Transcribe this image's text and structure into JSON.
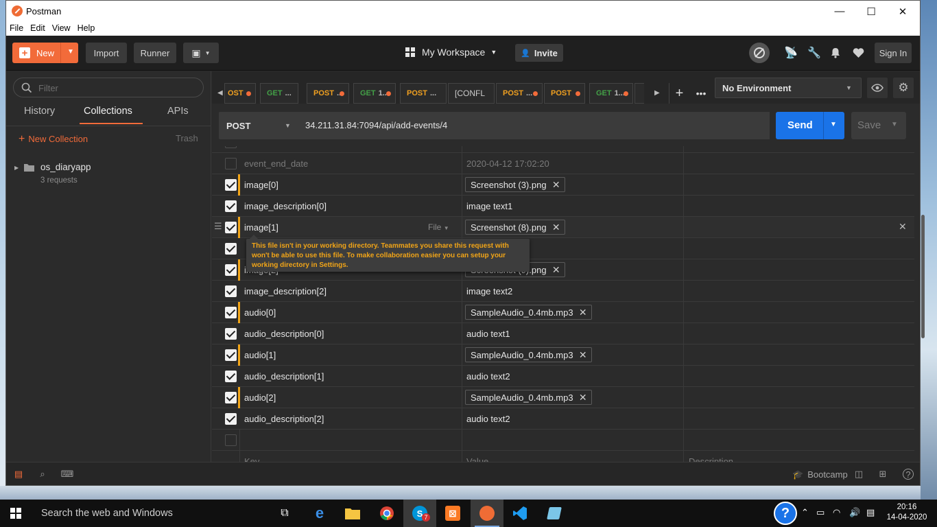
{
  "window": {
    "title": "Postman",
    "minimize": "—",
    "maximize": "☐",
    "close": "✕"
  },
  "menu": [
    "File",
    "Edit",
    "View",
    "Help"
  ],
  "header": {
    "new_label": "New",
    "import_label": "Import",
    "runner_label": "Runner",
    "workspace_label": "My Workspace",
    "invite_label": "Invite",
    "signin_label": "Sign In"
  },
  "sidebar": {
    "filter_placeholder": "Filter",
    "tabs": [
      "History",
      "Collections",
      "APIs"
    ],
    "new_collection": "New Collection",
    "trash": "Trash",
    "collection": {
      "name": "os_diaryapp",
      "count": "3 requests"
    }
  },
  "tabs": [
    {
      "method": "OST",
      "dot": true
    },
    {
      "method": "GET",
      "label": "...",
      "dot": false
    },
    {
      "method": "POST",
      "label": "...",
      "dot": true
    },
    {
      "method": "GET",
      "label": "1...",
      "dot": true
    },
    {
      "method": "POST",
      "label": "...",
      "dot": false
    },
    {
      "method": "",
      "label": "[CONFL",
      "dot": false
    },
    {
      "method": "POST",
      "label": "...",
      "dot": true
    },
    {
      "method": "POST",
      "label": "",
      "dot": true
    },
    {
      "method": "GET",
      "label": "1...",
      "dot": true
    }
  ],
  "environment": {
    "selected": "No Environment"
  },
  "request": {
    "method": "POST",
    "url": "34.211.31.84:7094/api/add-events/4",
    "send_label": "Send",
    "save_label": "Save"
  },
  "table": {
    "rows": [
      {
        "key": "event_end_date",
        "value": "2020-04-12 17:02:20",
        "checked": false,
        "file": false,
        "dim": true
      },
      {
        "key": "image[0]",
        "value": "Screenshot (3).png",
        "checked": true,
        "file": true
      },
      {
        "key": "image_description[0]",
        "value": "image text1",
        "checked": true,
        "file": false
      },
      {
        "key": "image[1]",
        "value": "Screenshot (8).png",
        "checked": true,
        "file": true,
        "type": "File"
      },
      {
        "key": "",
        "value": "",
        "checked": true,
        "file": false
      },
      {
        "key": "image[2]",
        "value": "Screenshot (9).png",
        "checked": true,
        "file": true
      },
      {
        "key": "image_description[2]",
        "value": "image text2",
        "checked": true,
        "file": false
      },
      {
        "key": "audio[0]",
        "value": "SampleAudio_0.4mb.mp3",
        "checked": true,
        "file": true
      },
      {
        "key": "audio_description[0]",
        "value": "audio text1",
        "checked": true,
        "file": false
      },
      {
        "key": "audio[1]",
        "value": "SampleAudio_0.4mb.mp3",
        "checked": true,
        "file": true
      },
      {
        "key": "audio_description[1]",
        "value": "audio text2",
        "checked": true,
        "file": false
      },
      {
        "key": "audio[2]",
        "value": "SampleAudio_0.4mb.mp3",
        "checked": true,
        "file": true
      },
      {
        "key": "audio_description[2]",
        "value": "audio text2",
        "checked": true,
        "file": false
      }
    ],
    "placeholders": {
      "key": "Key",
      "value": "Value",
      "description": "Description"
    },
    "tooltip": "This file isn't in your working directory. Teammates you share this request with won't be able to use this file. To make collaboration easier you can setup your working directory in Settings."
  },
  "statusbar": {
    "bootcamp": "Bootcamp"
  },
  "taskbar": {
    "search_text": "Search the web and Windows",
    "time": "20:16",
    "date": "14-04-2020",
    "skype_badge": "7"
  }
}
